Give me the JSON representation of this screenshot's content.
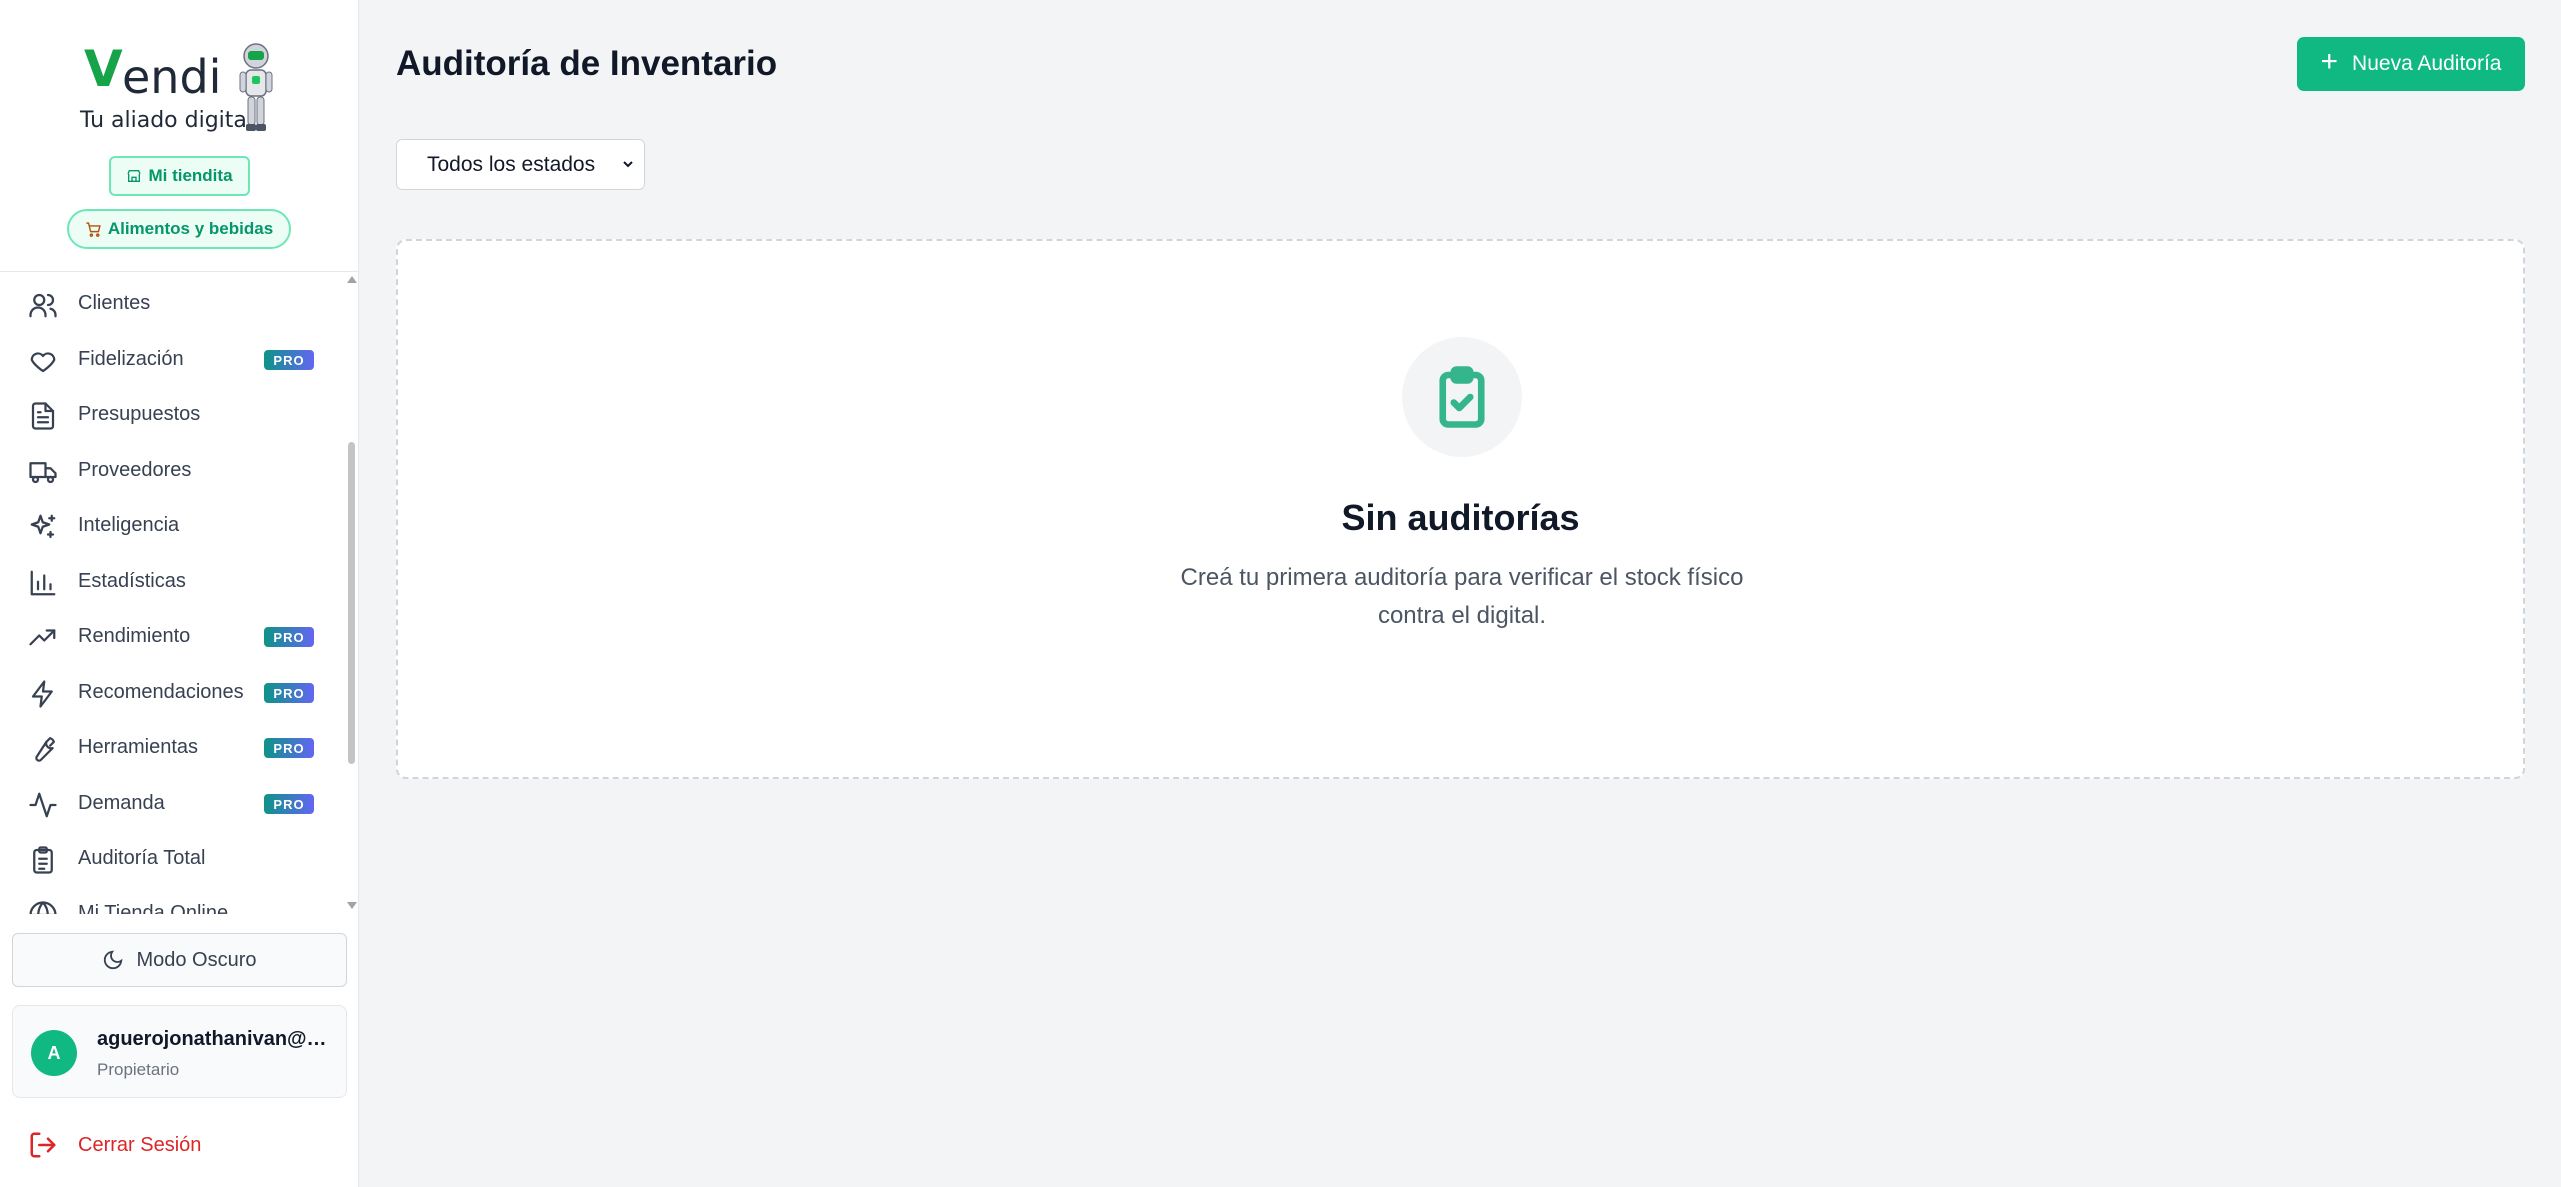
{
  "sidebar": {
    "logo": {
      "brand": "endi",
      "tagline": "Tu aliado digital"
    },
    "store_chip": "Mi tiendita",
    "category_chip": "Alimentos y bebidas",
    "items": [
      {
        "label": "Clientes",
        "icon": "users-icon",
        "pro": false
      },
      {
        "label": "Fidelización",
        "icon": "heart-icon",
        "pro": true
      },
      {
        "label": "Presupuestos",
        "icon": "file-text-icon",
        "pro": false
      },
      {
        "label": "Proveedores",
        "icon": "truck-icon",
        "pro": false
      },
      {
        "label": "Inteligencia",
        "icon": "sparkles-icon",
        "pro": false
      },
      {
        "label": "Estadísticas",
        "icon": "bar-chart-icon",
        "pro": false
      },
      {
        "label": "Rendimiento",
        "icon": "trending-up-icon",
        "pro": true
      },
      {
        "label": "Recomendaciones",
        "icon": "zap-icon",
        "pro": true
      },
      {
        "label": "Herramientas",
        "icon": "wrench-icon",
        "pro": true
      },
      {
        "label": "Demanda",
        "icon": "activity-icon",
        "pro": true
      },
      {
        "label": "Auditoría Total",
        "icon": "clipboard-list-icon",
        "pro": false
      },
      {
        "label": "Mi Tienda Online",
        "icon": "globe-icon",
        "pro": false
      }
    ],
    "pro_badge": "PRO",
    "dark_mode_label": "Modo Oscuro",
    "user": {
      "initial": "A",
      "email": "aguerojonathanivan@g...",
      "role": "Propietario"
    },
    "logout_label": "Cerrar Sesión"
  },
  "main": {
    "title": "Auditoría de Inventario",
    "new_button_label": "Nueva Auditoría",
    "filter": {
      "selected": "Todos los estados"
    },
    "empty_state": {
      "title": "Sin auditorías",
      "line1": "Creá tu primera auditoría para verificar el stock físico",
      "line2": "contra el digital."
    }
  },
  "colors": {
    "accent": "#10b981",
    "danger": "#dc2626",
    "background": "#f3f4f6"
  }
}
